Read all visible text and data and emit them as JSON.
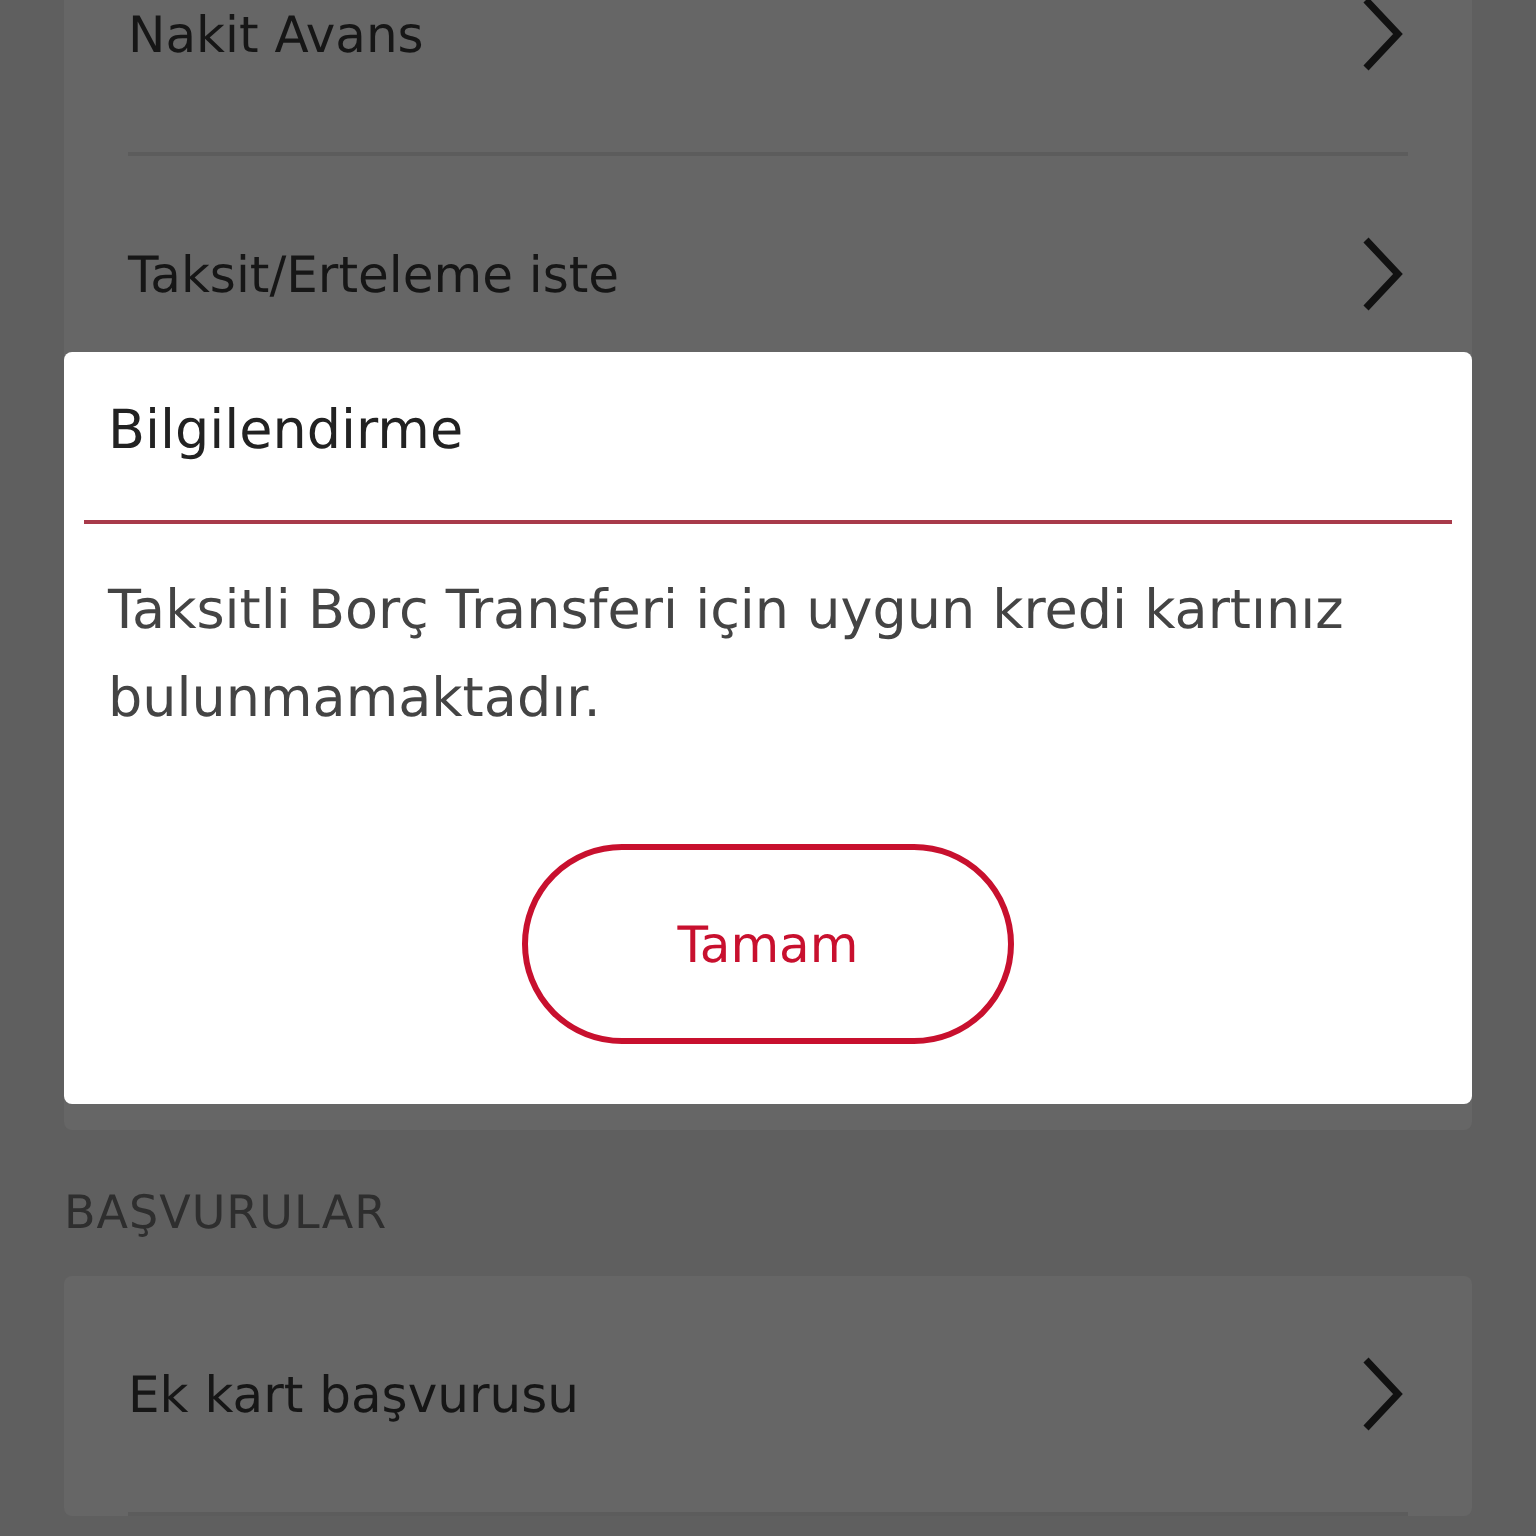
{
  "sections": [
    {
      "items": [
        {
          "label": "Nakit Avans"
        },
        {
          "label": "Taksit/Erteleme iste"
        }
      ]
    },
    {
      "heading": "BAŞVURULAR",
      "items": [
        {
          "label": "Ek kart başvurusu"
        }
      ]
    }
  ],
  "dialog": {
    "title": "Bilgilendirme",
    "message": "Taksitli Borç Transferi için uygun kredi kartınız bulunmamaktadır.",
    "button": "Tamam"
  }
}
